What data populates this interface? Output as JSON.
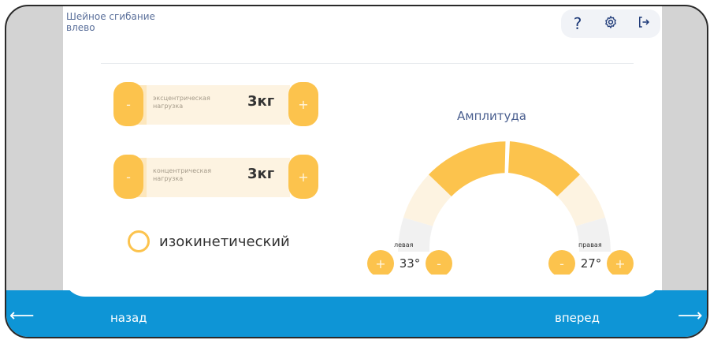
{
  "header": {
    "title_line1": "Шейное сгибание",
    "title_line2": "влево",
    "help_icon": "?",
    "settings_icon": "⚙",
    "logout_icon": "⇥"
  },
  "weights": [
    {
      "label": "эксцентрическая нагрузка",
      "value": "3кг",
      "minus": "-",
      "plus": "+"
    },
    {
      "label": "концентрическая нагрузка",
      "value": "3кг",
      "minus": "-",
      "plus": "+"
    }
  ],
  "isokinetic": {
    "label": "изокинетический",
    "checked": false
  },
  "amplitude": {
    "title": "Амплитуда",
    "left": {
      "label": "левая",
      "value": "33°",
      "plus": "+",
      "minus": "-"
    },
    "right": {
      "label": "правая",
      "value": "27°",
      "minus": "-",
      "plus": "+"
    }
  },
  "nav": {
    "back": "назад",
    "forward": "вперед",
    "back_arrow": "⟵",
    "forward_arrow": "⟶"
  },
  "colors": {
    "accent": "#fcc34d",
    "accent_light": "#fdf3e1",
    "nav_blue": "#0e95d6",
    "title_blue": "#4a5f8f"
  }
}
